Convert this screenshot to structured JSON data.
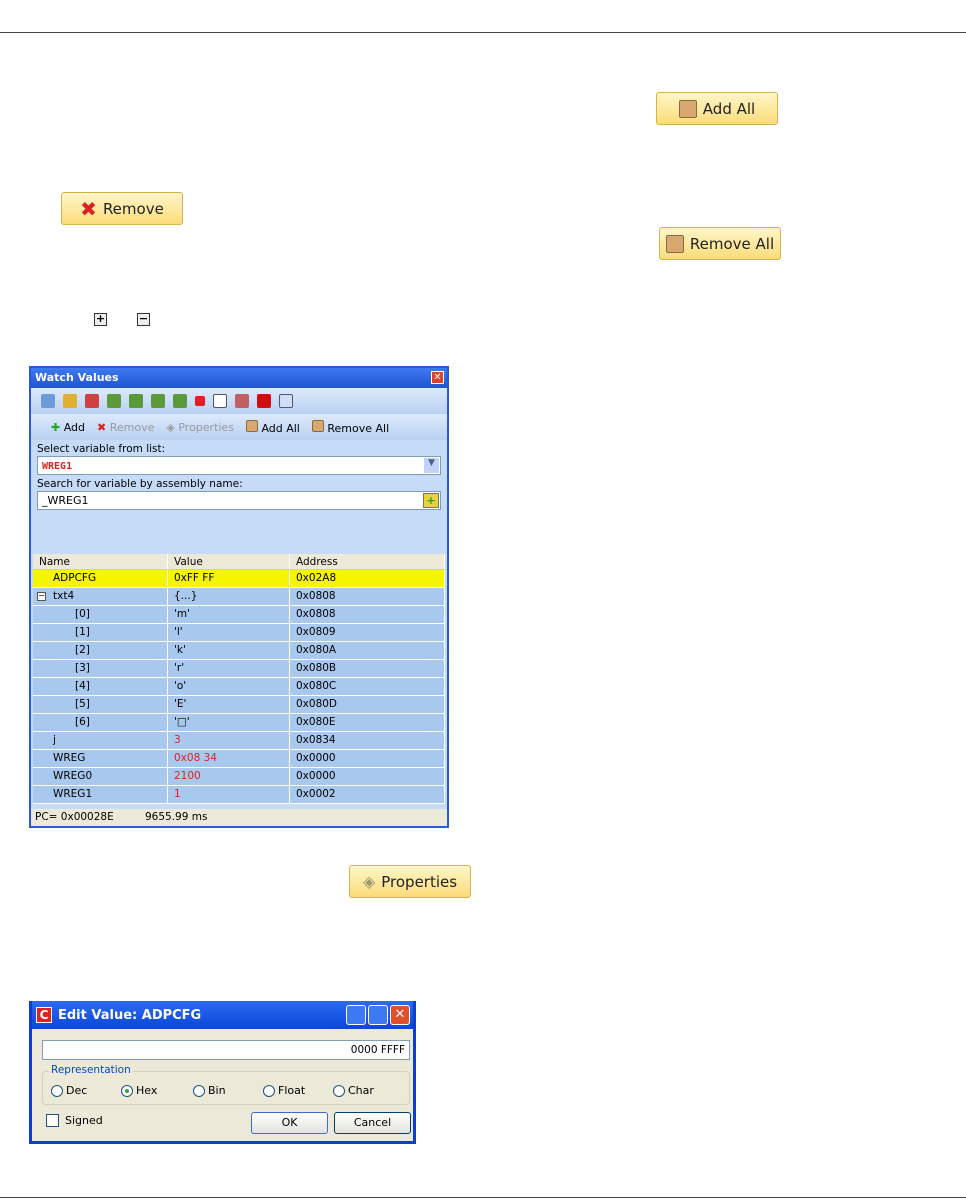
{
  "buttons": {
    "add_all": "Add All",
    "remove": "Remove",
    "remove_all": "Remove All",
    "properties": "Properties",
    "expand": "+",
    "collapse": "−"
  },
  "watch": {
    "title": "Watch Values",
    "toolbar": {
      "add": "Add",
      "remove": "Remove",
      "properties": "Properties",
      "add_all": "Add All",
      "remove_all": "Remove All"
    },
    "select_label": "Select variable from list:",
    "select_value": "WREG1",
    "search_label": "Search for variable by assembly name:",
    "search_value": "_WREG1",
    "columns": [
      "Name",
      "Value",
      "Address"
    ],
    "rows": [
      {
        "name": "ADPCFG",
        "value": "0xFF FF",
        "address": "0x02A8"
      },
      {
        "name": "txt4",
        "value": "{...}",
        "address": "0x0808"
      },
      {
        "name": "[0]",
        "value": "'m'",
        "address": "0x0808"
      },
      {
        "name": "[1]",
        "value": "'l'",
        "address": "0x0809"
      },
      {
        "name": "[2]",
        "value": "'k'",
        "address": "0x080A"
      },
      {
        "name": "[3]",
        "value": "'r'",
        "address": "0x080B"
      },
      {
        "name": "[4]",
        "value": "'o'",
        "address": "0x080C"
      },
      {
        "name": "[5]",
        "value": "'E'",
        "address": "0x080D"
      },
      {
        "name": "[6]",
        "value": "'□'",
        "address": "0x080E"
      },
      {
        "name": "j",
        "value": "3",
        "address": "0x0834"
      },
      {
        "name": "WREG",
        "value": "0x08 34",
        "address": "0x0000"
      },
      {
        "name": "WREG0",
        "value": "2100",
        "address": "0x0000"
      },
      {
        "name": "WREG1",
        "value": "1",
        "address": "0x0002"
      }
    ],
    "status_pc": "PC= 0x00028E",
    "status_time": "9655.99 ms"
  },
  "edit": {
    "title": "Edit Value: ADPCFG",
    "app_icon": "C",
    "value": "0000 FFFF",
    "group": "Representation",
    "options": [
      "Dec",
      "Hex",
      "Bin",
      "Float",
      "Char"
    ],
    "selected": "Hex",
    "signed": "Signed",
    "ok": "OK",
    "cancel": "Cancel"
  }
}
